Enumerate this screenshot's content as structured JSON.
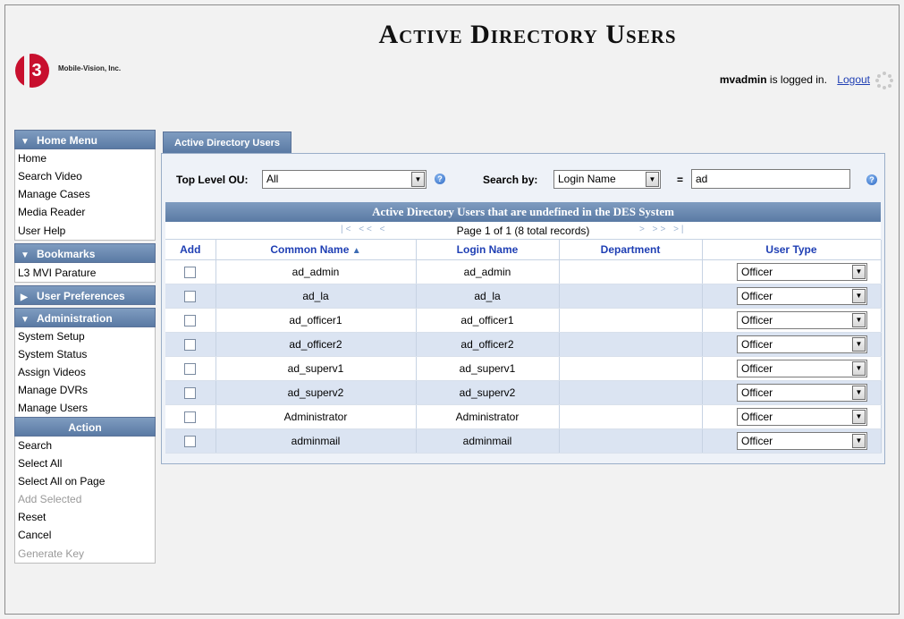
{
  "header": {
    "title": "Active Directory Users",
    "logo_mark": "3",
    "logo_text": "Mobile-Vision, Inc.",
    "user": "mvadmin",
    "logged_in_text": " is logged in.",
    "logout_label": "Logout"
  },
  "sidebar": {
    "home_menu": {
      "label": "Home Menu",
      "items": [
        "Home",
        "Search Video",
        "Manage Cases",
        "Media Reader",
        "User Help"
      ]
    },
    "bookmarks": {
      "label": "Bookmarks",
      "items": [
        "L3 MVI Parature"
      ]
    },
    "user_preferences": {
      "label": "User Preferences"
    },
    "administration": {
      "label": "Administration",
      "items": [
        "System Setup",
        "System Status",
        "Assign Videos",
        "Manage DVRs",
        "Manage Users"
      ]
    },
    "action": {
      "label": "Action",
      "items": [
        {
          "label": "Search",
          "enabled": true
        },
        {
          "label": "Select All",
          "enabled": true
        },
        {
          "label": "Select All on Page",
          "enabled": true
        },
        {
          "label": "Add Selected",
          "enabled": false
        },
        {
          "label": "Reset",
          "enabled": true
        },
        {
          "label": "Cancel",
          "enabled": true
        },
        {
          "label": "Generate Key",
          "enabled": false
        }
      ]
    }
  },
  "main": {
    "tab_label": "Active Directory Users",
    "search": {
      "top_level_ou_label": "Top Level OU:",
      "top_level_ou_value": "All",
      "search_by_label": "Search by:",
      "search_by_value": "Login Name",
      "operator": "=",
      "search_value": "ad"
    },
    "grid": {
      "title": "Active Directory Users that are undefined in the DES System",
      "pager_text": "Page 1 of 1 (8 total records)",
      "columns": {
        "add": "Add",
        "common_name": "Common Name",
        "login_name": "Login Name",
        "department": "Department",
        "user_type": "User Type"
      },
      "rows": [
        {
          "common_name": "ad_admin",
          "login_name": "ad_admin",
          "department": "",
          "user_type": "Officer"
        },
        {
          "common_name": "ad_la",
          "login_name": "ad_la",
          "department": "",
          "user_type": "Officer"
        },
        {
          "common_name": "ad_officer1",
          "login_name": "ad_officer1",
          "department": "",
          "user_type": "Officer"
        },
        {
          "common_name": "ad_officer2",
          "login_name": "ad_officer2",
          "department": "",
          "user_type": "Officer"
        },
        {
          "common_name": "ad_superv1",
          "login_name": "ad_superv1",
          "department": "",
          "user_type": "Officer"
        },
        {
          "common_name": "ad_superv2",
          "login_name": "ad_superv2",
          "department": "",
          "user_type": "Officer"
        },
        {
          "common_name": "Administrator",
          "login_name": "Administrator",
          "department": "",
          "user_type": "Officer"
        },
        {
          "common_name": "adminmail",
          "login_name": "adminmail",
          "department": "",
          "user_type": "Officer"
        }
      ]
    }
  }
}
